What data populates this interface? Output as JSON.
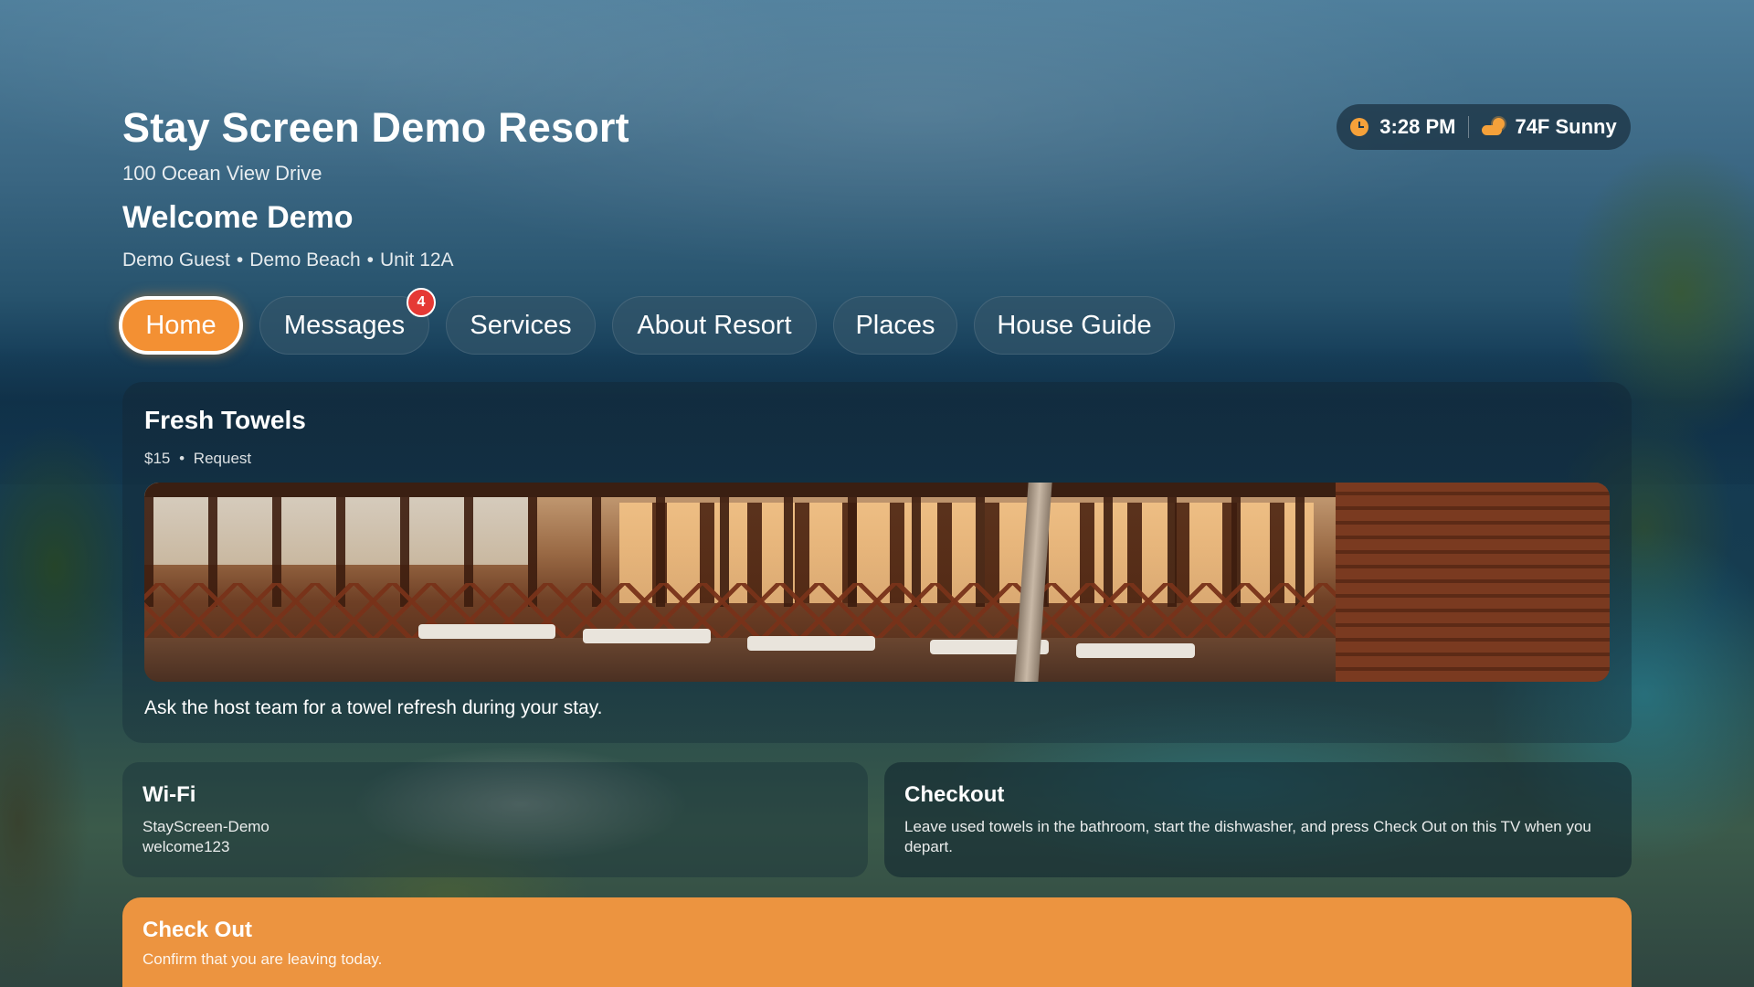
{
  "header": {
    "resort_name": "Stay Screen Demo Resort",
    "address": "100 Ocean View Drive",
    "welcome": "Welcome Demo",
    "guest_name": "Demo Guest",
    "property": "Demo Beach",
    "unit": "Unit 12A",
    "separator": "•"
  },
  "status": {
    "time": "3:28 PM",
    "weather": "74F Sunny",
    "clock_icon": "clock-icon",
    "weather_icon": "partly-sunny-icon"
  },
  "nav": {
    "tabs": [
      {
        "label": "Home",
        "active": true
      },
      {
        "label": "Messages",
        "badge": "4"
      },
      {
        "label": "Services"
      },
      {
        "label": "About Resort"
      },
      {
        "label": "Places"
      },
      {
        "label": "House Guide"
      }
    ]
  },
  "featured": {
    "title": "Fresh Towels",
    "price": "$15",
    "separator": "•",
    "action": "Request",
    "description": "Ask the host team for a towel refresh during your stay."
  },
  "wifi": {
    "title": "Wi-Fi",
    "network": "StayScreen-Demo",
    "password": "welcome123"
  },
  "checkout_info": {
    "title": "Checkout",
    "text": "Leave used towels in the bathroom, start the dishwasher, and press Check Out on this TV when you depart."
  },
  "checkout_action": {
    "title": "Check Out",
    "subtitle": "Confirm that you are leaving today."
  },
  "colors": {
    "accent": "#f39033",
    "badge": "#e53935",
    "checkout_button": "#ec9440"
  }
}
